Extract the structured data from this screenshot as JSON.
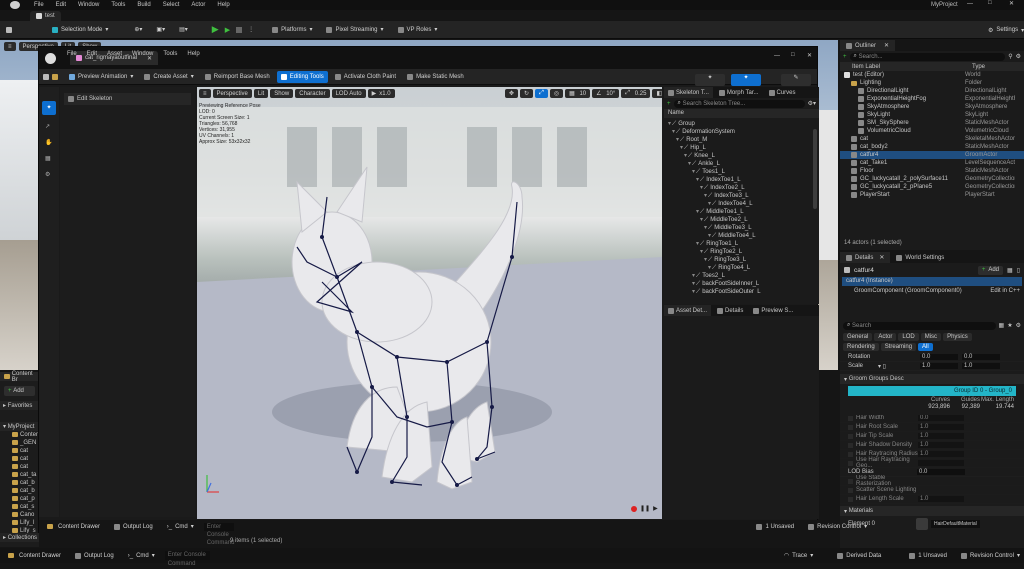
{
  "main_menu": [
    "File",
    "Edit",
    "Window",
    "Tools",
    "Build",
    "Select",
    "Actor",
    "Help"
  ],
  "project_name": "MyProject",
  "level_tab": "test",
  "main_toolbar": {
    "selection_mode": "Selection Mode",
    "platforms": "Platforms",
    "pixel_streaming": "Pixel Streaming",
    "vp_roles": "VP Roles",
    "settings": "Settings"
  },
  "level_viewport": {
    "perspective": "Perspective",
    "lit": "Lit",
    "show": "Show"
  },
  "editor": {
    "tab": "cat_rigmayaoutfinal",
    "menu": [
      "File",
      "Edit",
      "Asset",
      "Window",
      "Tools",
      "Help"
    ],
    "toolbar": {
      "preview_animation": "Preview Animation",
      "create_asset": "Create Asset",
      "reimport": "Reimport Base Mesh",
      "editing_tools": "Editing Tools",
      "cloth_paint": "Activate Cloth Paint",
      "static_mesh": "Make Static Mesh"
    },
    "edit_skeleton": "Edit Skeleton",
    "viewport": {
      "perspective": "Perspective",
      "lit": "Lit",
      "show": "Show",
      "character": "Character",
      "lod": "LOD Auto",
      "speed": "x1.0",
      "snap_grid": "10",
      "snap_rot": "10°",
      "snap_scale": "0.25",
      "cam_speed": "4"
    },
    "info": [
      "Previewing Reference Pose",
      "LOD: 0",
      "Current Screen Size: 1",
      "Triangles: 56,768",
      "Vertices: 31,955",
      "UV Channels: 1",
      "Approx Size: 53x32x32"
    ],
    "skel_tabs": [
      "Skeleton T...",
      "Morph Tar...",
      "Curves"
    ],
    "search_ph": "Search Skeleton Tree...",
    "name_header": "Name",
    "bones": [
      "Group",
      "DeformationSystem",
      "Root_M",
      "Hip_L",
      "Knee_L",
      "Ankle_L",
      "Toes1_L",
      "IndexToe1_L",
      "IndexToe2_L",
      "IndexToe3_L",
      "IndexToe4_L",
      "MiddleToe1_L",
      "MiddleToe2_L",
      "MiddleToe3_L",
      "MiddleToe4_L",
      "RingToe1_L",
      "RingToe2_L",
      "RingToe3_L",
      "RingToe4_L",
      "Toes2_L",
      "backFootSideInner_L",
      "backFootSideOuter_L"
    ],
    "bottom_tabs": [
      "Asset Det...",
      "Details",
      "Preview S..."
    ],
    "status": {
      "drawer": "Content Drawer",
      "output": "Output Log",
      "cmd": "Cmd",
      "console_ph": "Enter Console Command",
      "unsaved": "1 Unsaved",
      "revision": "Revision Control"
    }
  },
  "content": {
    "title": "Content Br",
    "add": "Add",
    "favorites": "Favorites",
    "project": "MyProject",
    "folders": [
      "Content",
      "_GEN",
      "cat",
      "cat",
      "cat",
      "cat_ta",
      "cat_b",
      "cat_b",
      "cat_p",
      "cat_s",
      "Cano",
      "Lify_l",
      "Lify_s"
    ],
    "collections": "Collections",
    "items": "9 items (1 selected)"
  },
  "outliner": {
    "title": "Outliner",
    "search_ph": "Search...",
    "col_label": "Item Label",
    "col_type": "Type",
    "rows": [
      {
        "l": "test (Editor)",
        "t": "World"
      },
      {
        "l": "Lighting",
        "t": "Folder"
      },
      {
        "l": "DirectionalLight",
        "t": "DirectionalLight"
      },
      {
        "l": "ExponentialHeightFog",
        "t": "ExponentialHeightFo"
      },
      {
        "l": "SkyAtmosphere",
        "t": "SkyAtmosphere"
      },
      {
        "l": "SkyLight",
        "t": "SkyLight"
      },
      {
        "l": "SM_SkySphere",
        "t": "StaticMeshActor"
      },
      {
        "l": "VolumetricCloud",
        "t": "VolumetricCloud"
      },
      {
        "l": "cat",
        "t": "SkeletalMeshActor"
      },
      {
        "l": "cat_body2",
        "t": "StaticMeshActor"
      },
      {
        "l": "catfur4",
        "t": "GroomActor"
      },
      {
        "l": "cat_Take1",
        "t": "LevelSequenceActo"
      },
      {
        "l": "Floor",
        "t": "StaticMeshActor"
      },
      {
        "l": "GC_luckycatall_2_polySurface11",
        "t": "GeometryCollection"
      },
      {
        "l": "GC_luckycatall_2_pPlane5",
        "t": "GeometryCollection"
      },
      {
        "l": "PlayerStart",
        "t": "PlayerStart"
      }
    ],
    "count": "14 actors (1 selected)"
  },
  "details": {
    "tab": "Details",
    "world_tab": "World Settings",
    "actor": "catfur4",
    "add": "Add",
    "instance": "catfur4 (Instance)",
    "component": "GroomComponent (GroomComponent0)",
    "edit_cpp": "Edit in C++",
    "search_ph": "Search",
    "filters": [
      "General",
      "Actor",
      "LOD",
      "Misc",
      "Physics",
      "Rendering",
      "Streaming",
      "All"
    ],
    "rot_label": "Rotation",
    "scale_label": "Scale",
    "v0": "0.0",
    "v1": "1.0",
    "groom_section": "Groom Groups Desc",
    "group_hdr": "Group ID 0 - Group_0",
    "stats_hdr": [
      "Curves",
      "Guides",
      "Max. Length"
    ],
    "stats_val": [
      "923,896",
      "92,389",
      "19.744"
    ],
    "props": [
      {
        "l": "Hair Width",
        "v": "0.0"
      },
      {
        "l": "Hair Root Scale",
        "v": "1.0"
      },
      {
        "l": "Hair Tip Scale",
        "v": "1.0"
      },
      {
        "l": "Hair Shadow Density",
        "v": "1.0"
      },
      {
        "l": "Hair Raytracing Radius",
        "v": "1.0"
      },
      {
        "l": "Use Hair Raytracing Geo...",
        "v": ""
      }
    ],
    "lod_bias": "LOD Bias",
    "lod_val": "0.0",
    "extra": [
      "Use Stable Rasterization",
      "Scatter Scene Lighting",
      "Hair Length Scale"
    ],
    "extra_val": "1.0",
    "materials": "Materials",
    "element": "Element 0",
    "material": "HairDefaultMaterial"
  },
  "statusbar": {
    "drawer": "Content Drawer",
    "output": "Output Log",
    "cmd": "Cmd",
    "console_ph": "Enter Console Command",
    "trace": "Trace",
    "derived": "Derived Data",
    "unsaved": "1 Unsaved",
    "revision": "Revision Control"
  },
  "colors": {
    "accent": "#0e6fd0",
    "cyan": "#23b5c8",
    "bone": "#161a46",
    "selected": "#1f4e80"
  }
}
